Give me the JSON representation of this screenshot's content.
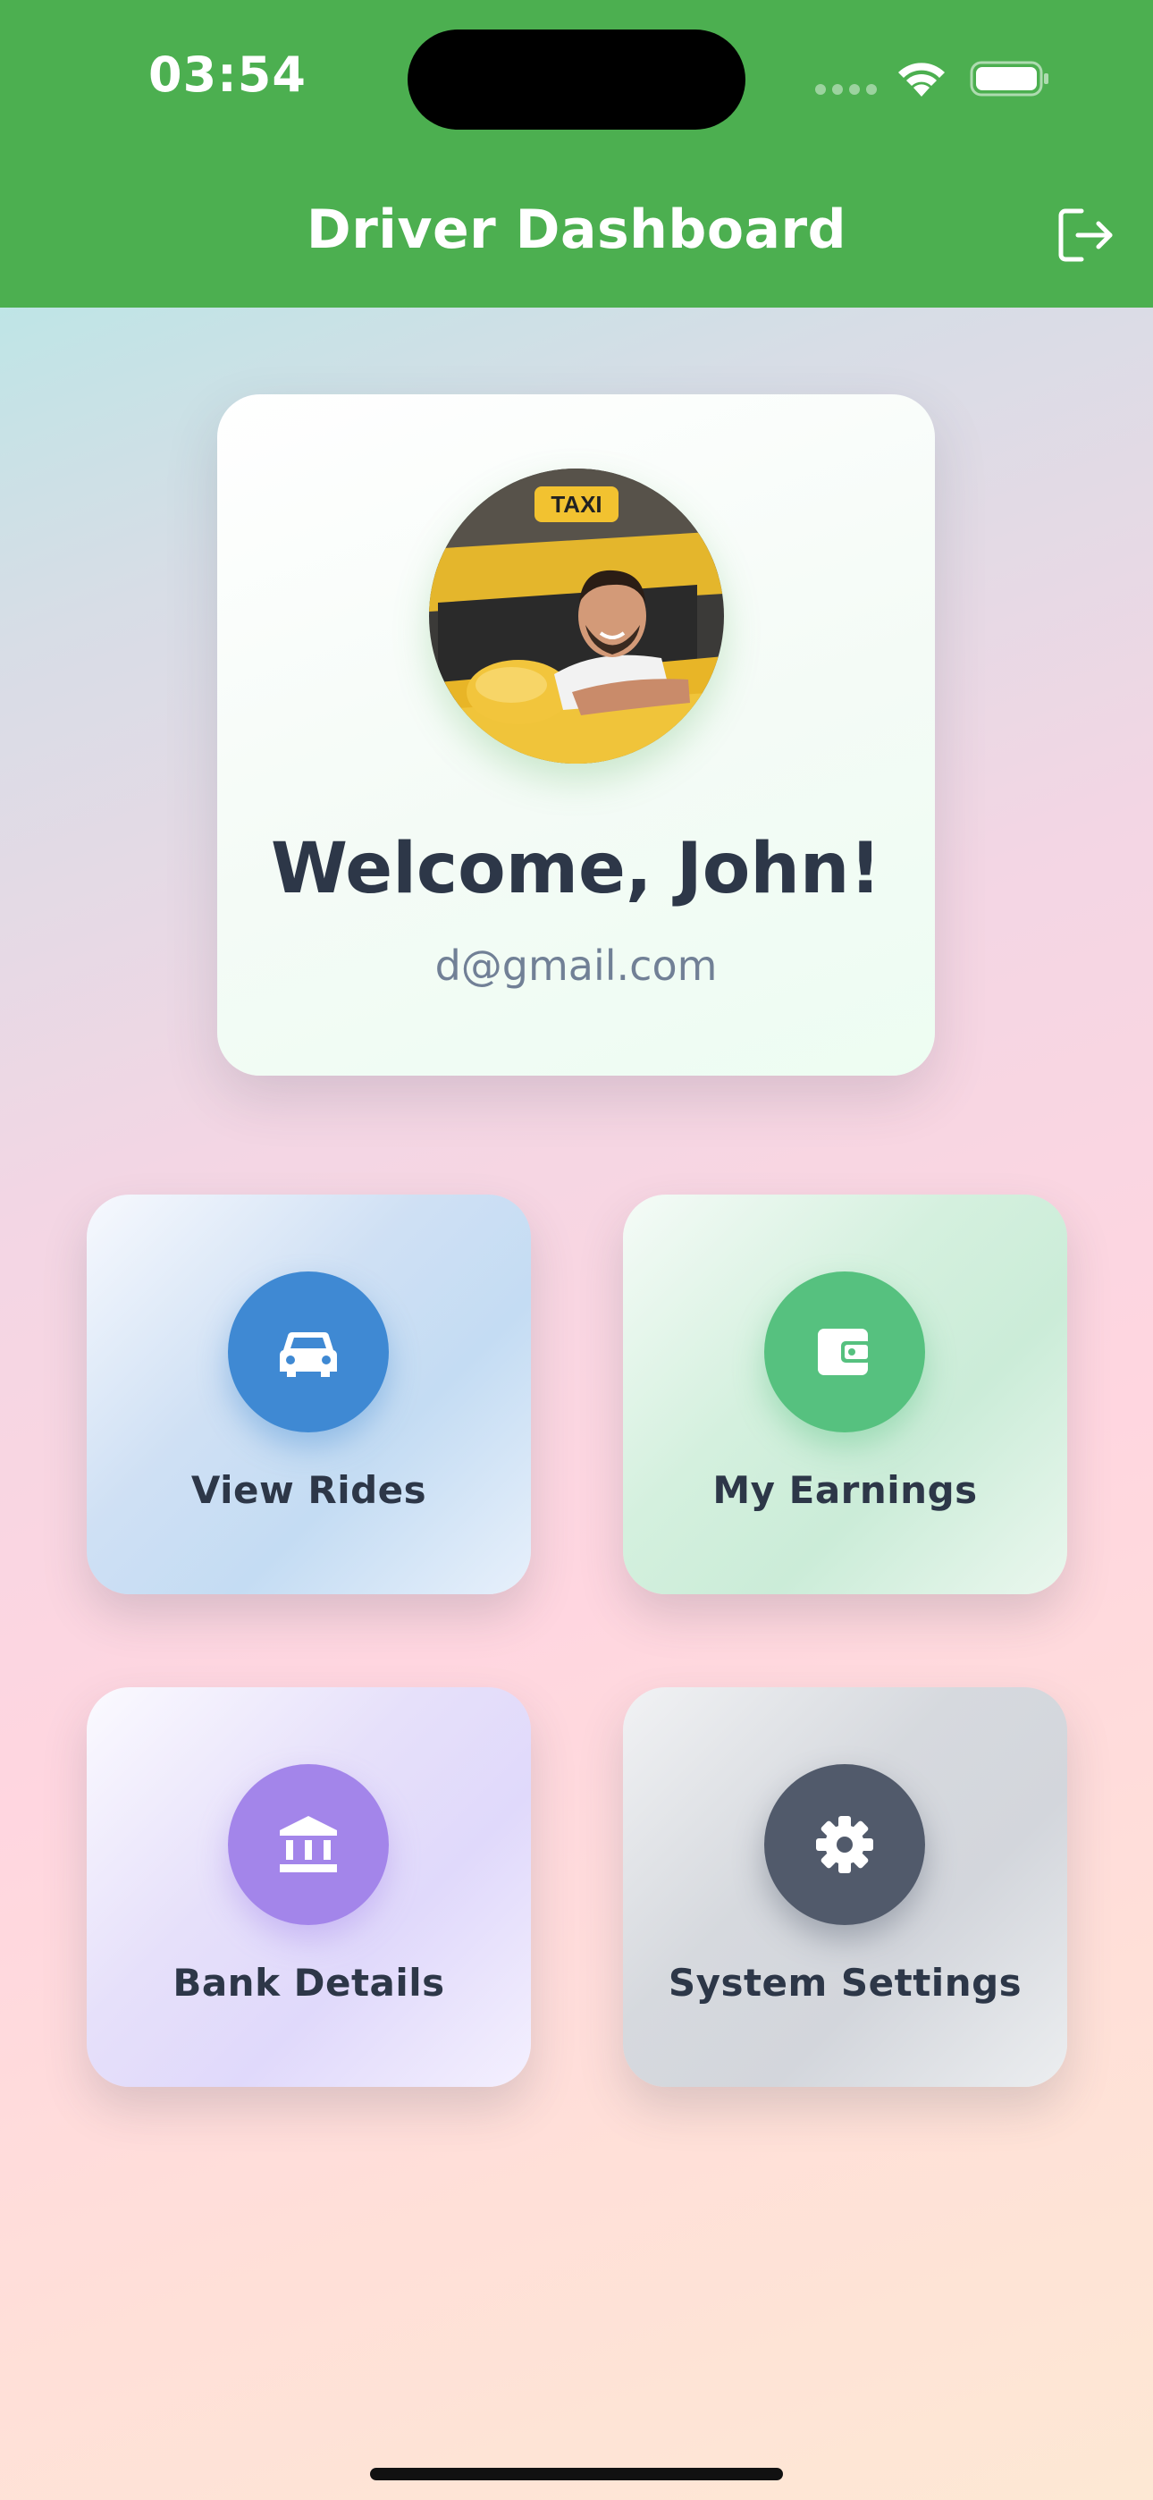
{
  "status_bar": {
    "time": "03:54"
  },
  "header": {
    "title": "Driver Dashboard",
    "logout_icon": "logout-icon",
    "color": "#4caf50"
  },
  "profile": {
    "welcome": "Welcome, John!",
    "email": "d@gmail.com",
    "avatar": "driver-in-taxi-photo"
  },
  "tiles": [
    {
      "label": "View Rides",
      "icon": "car-icon",
      "color": "#3f89d3"
    },
    {
      "label": "My Earnings",
      "icon": "wallet-icon",
      "color": "#56c17f"
    },
    {
      "label": "Bank Details",
      "icon": "bank-icon",
      "color": "#a385ea"
    },
    {
      "label": "System Settings",
      "icon": "gear-icon",
      "color": "#515a6b"
    }
  ]
}
